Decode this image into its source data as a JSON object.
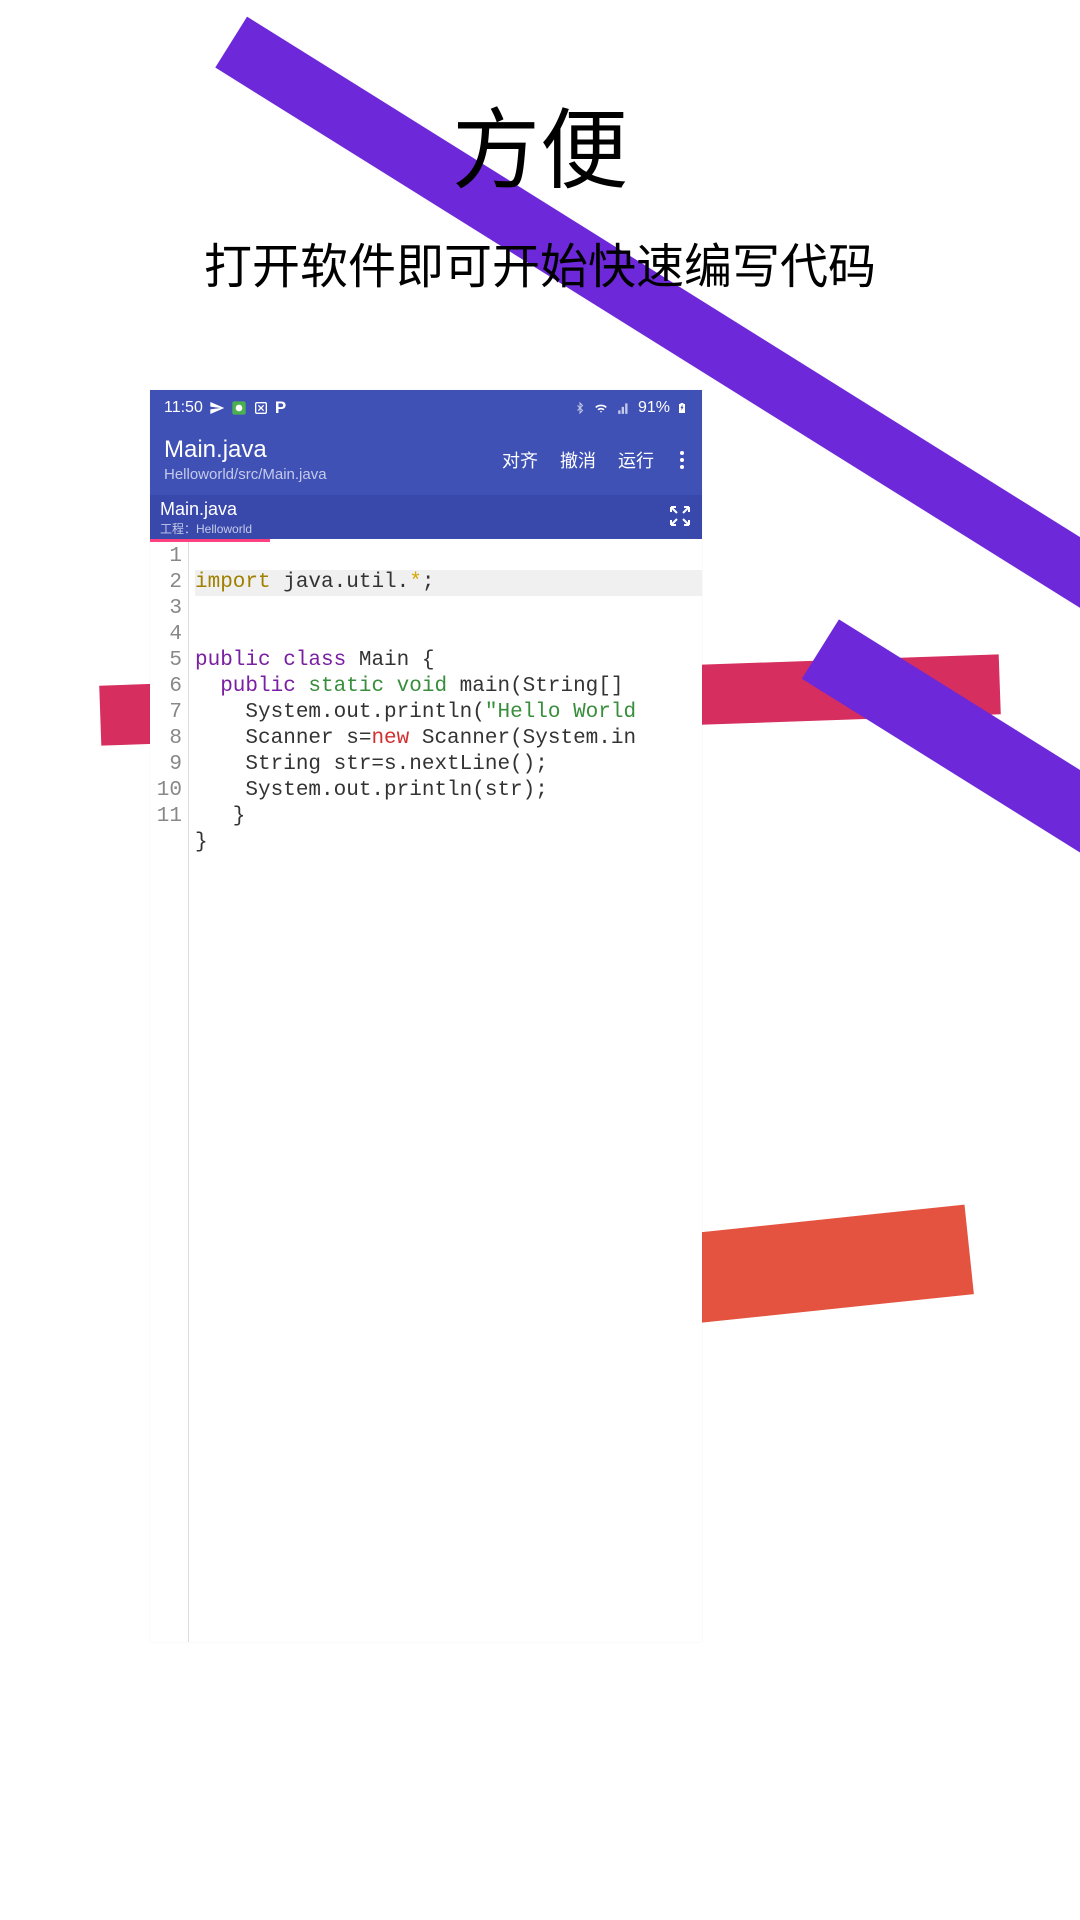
{
  "header": {
    "title": "方便",
    "subtitle": "打开软件即可开始快速编写代码"
  },
  "status": {
    "time": "11:50",
    "battery": "91%"
  },
  "appbar": {
    "title": "Main.java",
    "path": "Helloworld/src/Main.java",
    "actions": {
      "align": "对齐",
      "undo": "撤消",
      "run": "运行"
    }
  },
  "tab": {
    "name": "Main.java",
    "project_prefix": "工程：",
    "project_name": "Helloworld"
  },
  "code": {
    "lines": [
      "1",
      "2",
      "3",
      "4",
      "5",
      "6",
      "7",
      "8",
      "9",
      "10",
      "11"
    ],
    "l1_import": "import",
    "l1_rest": " java.util.",
    "l1_star": "*",
    "l1_semi": ";",
    "l3_public": "public",
    "l3_class": " class",
    "l3_rest": " Main {",
    "l4_public": "  public",
    "l4_static": " static",
    "l4_void": " void",
    "l4_rest": " main(String[]",
    "l5": "    System.out.println(",
    "l5_str": "\"Hello World",
    "l6a": "    Scanner s=",
    "l6_new": "new",
    "l6b": " Scanner(System.in",
    "l7": "    String str=s.nextLine();",
    "l8": "    System.out.println(str);",
    "l9": "   }",
    "l10": "}"
  }
}
